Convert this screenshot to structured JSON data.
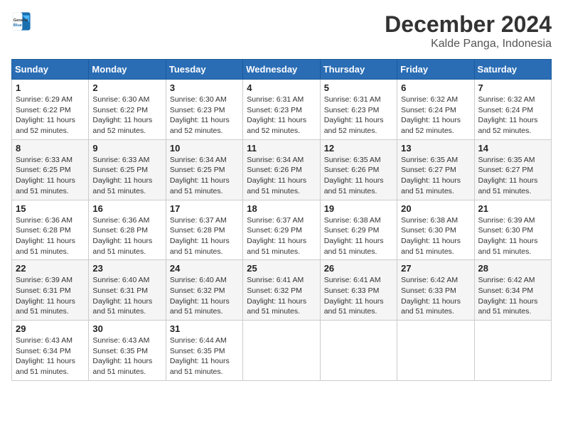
{
  "header": {
    "logo": {
      "line1": "General",
      "line2": "Blue"
    },
    "title": "December 2024",
    "subtitle": "Kalde Panga, Indonesia"
  },
  "calendar": {
    "days_of_week": [
      "Sunday",
      "Monday",
      "Tuesday",
      "Wednesday",
      "Thursday",
      "Friday",
      "Saturday"
    ],
    "weeks": [
      [
        {
          "day": "1",
          "sunrise": "6:29 AM",
          "sunset": "6:22 PM",
          "daylight": "11 hours and 52 minutes."
        },
        {
          "day": "2",
          "sunrise": "6:30 AM",
          "sunset": "6:22 PM",
          "daylight": "11 hours and 52 minutes."
        },
        {
          "day": "3",
          "sunrise": "6:30 AM",
          "sunset": "6:23 PM",
          "daylight": "11 hours and 52 minutes."
        },
        {
          "day": "4",
          "sunrise": "6:31 AM",
          "sunset": "6:23 PM",
          "daylight": "11 hours and 52 minutes."
        },
        {
          "day": "5",
          "sunrise": "6:31 AM",
          "sunset": "6:23 PM",
          "daylight": "11 hours and 52 minutes."
        },
        {
          "day": "6",
          "sunrise": "6:32 AM",
          "sunset": "6:24 PM",
          "daylight": "11 hours and 52 minutes."
        },
        {
          "day": "7",
          "sunrise": "6:32 AM",
          "sunset": "6:24 PM",
          "daylight": "11 hours and 52 minutes."
        }
      ],
      [
        {
          "day": "8",
          "sunrise": "6:33 AM",
          "sunset": "6:25 PM",
          "daylight": "11 hours and 51 minutes."
        },
        {
          "day": "9",
          "sunrise": "6:33 AM",
          "sunset": "6:25 PM",
          "daylight": "11 hours and 51 minutes."
        },
        {
          "day": "10",
          "sunrise": "6:34 AM",
          "sunset": "6:25 PM",
          "daylight": "11 hours and 51 minutes."
        },
        {
          "day": "11",
          "sunrise": "6:34 AM",
          "sunset": "6:26 PM",
          "daylight": "11 hours and 51 minutes."
        },
        {
          "day": "12",
          "sunrise": "6:35 AM",
          "sunset": "6:26 PM",
          "daylight": "11 hours and 51 minutes."
        },
        {
          "day": "13",
          "sunrise": "6:35 AM",
          "sunset": "6:27 PM",
          "daylight": "11 hours and 51 minutes."
        },
        {
          "day": "14",
          "sunrise": "6:35 AM",
          "sunset": "6:27 PM",
          "daylight": "11 hours and 51 minutes."
        }
      ],
      [
        {
          "day": "15",
          "sunrise": "6:36 AM",
          "sunset": "6:28 PM",
          "daylight": "11 hours and 51 minutes."
        },
        {
          "day": "16",
          "sunrise": "6:36 AM",
          "sunset": "6:28 PM",
          "daylight": "11 hours and 51 minutes."
        },
        {
          "day": "17",
          "sunrise": "6:37 AM",
          "sunset": "6:28 PM",
          "daylight": "11 hours and 51 minutes."
        },
        {
          "day": "18",
          "sunrise": "6:37 AM",
          "sunset": "6:29 PM",
          "daylight": "11 hours and 51 minutes."
        },
        {
          "day": "19",
          "sunrise": "6:38 AM",
          "sunset": "6:29 PM",
          "daylight": "11 hours and 51 minutes."
        },
        {
          "day": "20",
          "sunrise": "6:38 AM",
          "sunset": "6:30 PM",
          "daylight": "11 hours and 51 minutes."
        },
        {
          "day": "21",
          "sunrise": "6:39 AM",
          "sunset": "6:30 PM",
          "daylight": "11 hours and 51 minutes."
        }
      ],
      [
        {
          "day": "22",
          "sunrise": "6:39 AM",
          "sunset": "6:31 PM",
          "daylight": "11 hours and 51 minutes."
        },
        {
          "day": "23",
          "sunrise": "6:40 AM",
          "sunset": "6:31 PM",
          "daylight": "11 hours and 51 minutes."
        },
        {
          "day": "24",
          "sunrise": "6:40 AM",
          "sunset": "6:32 PM",
          "daylight": "11 hours and 51 minutes."
        },
        {
          "day": "25",
          "sunrise": "6:41 AM",
          "sunset": "6:32 PM",
          "daylight": "11 hours and 51 minutes."
        },
        {
          "day": "26",
          "sunrise": "6:41 AM",
          "sunset": "6:33 PM",
          "daylight": "11 hours and 51 minutes."
        },
        {
          "day": "27",
          "sunrise": "6:42 AM",
          "sunset": "6:33 PM",
          "daylight": "11 hours and 51 minutes."
        },
        {
          "day": "28",
          "sunrise": "6:42 AM",
          "sunset": "6:34 PM",
          "daylight": "11 hours and 51 minutes."
        }
      ],
      [
        {
          "day": "29",
          "sunrise": "6:43 AM",
          "sunset": "6:34 PM",
          "daylight": "11 hours and 51 minutes."
        },
        {
          "day": "30",
          "sunrise": "6:43 AM",
          "sunset": "6:35 PM",
          "daylight": "11 hours and 51 minutes."
        },
        {
          "day": "31",
          "sunrise": "6:44 AM",
          "sunset": "6:35 PM",
          "daylight": "11 hours and 51 minutes."
        },
        null,
        null,
        null,
        null
      ]
    ]
  }
}
